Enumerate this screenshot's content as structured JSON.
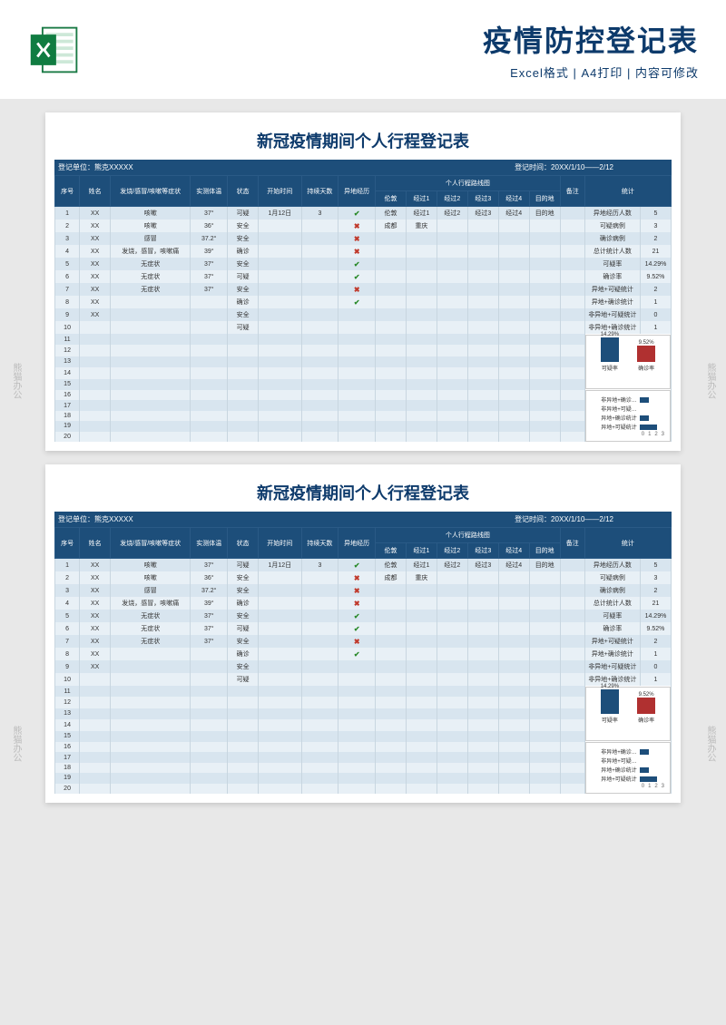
{
  "header": {
    "title": "疫情防控登记表",
    "subtitle": "Excel格式 | A4打印 | 内容可修改"
  },
  "sheet": {
    "title": "新冠疫情期间个人行程登记表",
    "meta_left": "登记单位：熊克XXXXX",
    "meta_right": "登记时间：20XX/1/10——2/12",
    "columns": [
      "序号",
      "姓名",
      "发烧/感冒/咳嗽等症状",
      "实测体温",
      "状态",
      "开始时间",
      "持续天数",
      "异地经历",
      "个人行程路线图",
      "备注",
      "统计"
    ],
    "route_sub": [
      "伦敦",
      "经过1",
      "经过2",
      "经过3",
      "经过4",
      "目的地"
    ],
    "rows": [
      {
        "n": "1",
        "name": "XX",
        "sym": "咳嗽",
        "temp": "37°",
        "status": "可疑",
        "start": "1月12日",
        "days": "3",
        "away": "ok",
        "route": [
          "伦敦",
          "经过1",
          "经过2",
          "经过3",
          "经过4",
          "目的地"
        ]
      },
      {
        "n": "2",
        "name": "XX",
        "sym": "咳嗽",
        "temp": "36°",
        "status": "安全",
        "start": "",
        "days": "",
        "away": "no",
        "route": [
          "成都",
          "重庆",
          "",
          "",
          "",
          ""
        ]
      },
      {
        "n": "3",
        "name": "XX",
        "sym": "感冒",
        "temp": "37.2°",
        "status": "安全",
        "start": "",
        "days": "",
        "away": "no",
        "route": [
          "",
          "",
          "",
          "",
          "",
          ""
        ]
      },
      {
        "n": "4",
        "name": "XX",
        "sym": "发烧，感冒，咳嗽痛",
        "temp": "39°",
        "status": "确诊",
        "start": "",
        "days": "",
        "away": "no",
        "route": [
          "",
          "",
          "",
          "",
          "",
          ""
        ]
      },
      {
        "n": "5",
        "name": "XX",
        "sym": "无症状",
        "temp": "37°",
        "status": "安全",
        "start": "",
        "days": "",
        "away": "ok",
        "route": [
          "",
          "",
          "",
          "",
          "",
          ""
        ]
      },
      {
        "n": "6",
        "name": "XX",
        "sym": "无症状",
        "temp": "37°",
        "status": "可疑",
        "start": "",
        "days": "",
        "away": "ok",
        "route": [
          "",
          "",
          "",
          "",
          "",
          ""
        ]
      },
      {
        "n": "7",
        "name": "XX",
        "sym": "无症状",
        "temp": "37°",
        "status": "安全",
        "start": "",
        "days": "",
        "away": "no",
        "route": [
          "",
          "",
          "",
          "",
          "",
          ""
        ]
      },
      {
        "n": "8",
        "name": "XX",
        "sym": "",
        "temp": "",
        "status": "确诊",
        "start": "",
        "days": "",
        "away": "ok",
        "route": [
          "",
          "",
          "",
          "",
          "",
          ""
        ]
      },
      {
        "n": "9",
        "name": "XX",
        "sym": "",
        "temp": "",
        "status": "安全",
        "start": "",
        "days": "",
        "away": "",
        "route": [
          "",
          "",
          "",
          "",
          "",
          ""
        ]
      },
      {
        "n": "10",
        "name": "",
        "sym": "",
        "temp": "",
        "status": "可疑",
        "start": "",
        "days": "",
        "away": "",
        "route": [
          "",
          "",
          "",
          "",
          "",
          ""
        ]
      },
      {
        "n": "11"
      },
      {
        "n": "12"
      },
      {
        "n": "13"
      },
      {
        "n": "14"
      },
      {
        "n": "15"
      },
      {
        "n": "16"
      },
      {
        "n": "17"
      },
      {
        "n": "18"
      },
      {
        "n": "19"
      },
      {
        "n": "20"
      }
    ],
    "stats": [
      {
        "label": "异地经历人数",
        "value": "5"
      },
      {
        "label": "可疑病例",
        "value": "3"
      },
      {
        "label": "确诊病例",
        "value": "2"
      },
      {
        "label": "总计统计人数",
        "value": "21"
      },
      {
        "label": "可疑率",
        "value": "14.29%"
      },
      {
        "label": "确诊率",
        "value": "9.52%"
      },
      {
        "label": "异地+可疑统计",
        "value": "2"
      },
      {
        "label": "异地+确诊统计",
        "value": "1"
      },
      {
        "label": "非异地+可疑统计",
        "value": "0"
      },
      {
        "label": "非异地+确诊统计",
        "value": "1"
      }
    ]
  },
  "chart_data": [
    {
      "type": "bar",
      "categories": [
        "可疑率",
        "确诊率"
      ],
      "values": [
        14.29,
        9.52
      ],
      "colors": [
        "#1d4e7a",
        "#b03030"
      ],
      "ylim": [
        0,
        16
      ]
    },
    {
      "type": "bar",
      "orientation": "horizontal",
      "categories": [
        "非异地+确诊…",
        "非异地+可疑…",
        "异地+确诊统计",
        "异地+可疑统计"
      ],
      "values": [
        1,
        0,
        1,
        2
      ],
      "xlim": [
        0,
        3
      ],
      "axis_labels": [
        "0",
        "1",
        "2",
        "3"
      ]
    }
  ],
  "watermark": "熊猫办公"
}
